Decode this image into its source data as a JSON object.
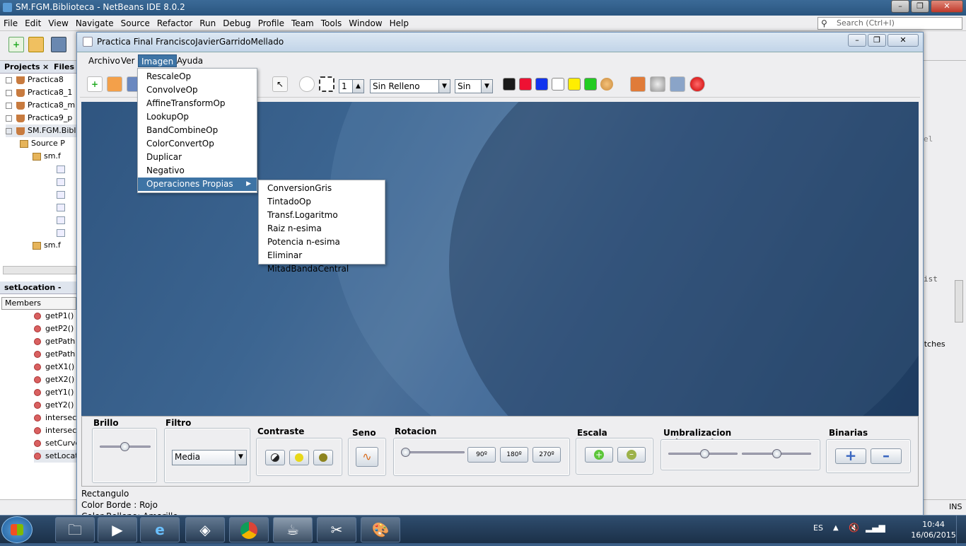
{
  "ide": {
    "title": "SM.FGM.Biblioteca - NetBeans IDE 8.0.2",
    "menu": [
      "File",
      "Edit",
      "View",
      "Navigate",
      "Source",
      "Refactor",
      "Run",
      "Debug",
      "Profile",
      "Team",
      "Tools",
      "Window",
      "Help"
    ],
    "search_placeholder": "Search (Ctrl+I)",
    "projects_tab": "Projects",
    "files_tab": "Files",
    "projects": [
      "Practica8",
      "Practica8_1",
      "Practica8_m",
      "Practica9_p",
      "SM.FGM.Bibli",
      "Source P",
      "sm.f",
      "sm.f"
    ],
    "navigator_title": "setLocation - Navi",
    "members_label": "Members",
    "members": [
      "getP1()",
      "getP2()",
      "getPath",
      "getPath",
      "getX1()",
      "getX2()",
      "getY1()",
      "getY2()",
      "intersec",
      "intersec",
      "setCurve",
      "setLocat"
    ],
    "right_strip_texts": [
      "el",
      "ist",
      "atches"
    ],
    "status_ins": "INS"
  },
  "app": {
    "title": "Practica Final FranciscoJavierGarridoMellado",
    "menu": {
      "archivo": "Archivo",
      "ver": "Ver",
      "imagen": "Imagen",
      "ayuda": "Ayuda"
    },
    "toolbar": {
      "stroke_value": "1",
      "fill_combo": "Sin Relleno",
      "sin_combo": "Sin",
      "colors": [
        "#1a1a1a",
        "#ee1133",
        "#1133ee",
        "#ffffff",
        "#ffee00",
        "#22cc22"
      ]
    },
    "imagen_menu": [
      "RescaleOp",
      "ConvolveOp",
      "AffineTransformOp",
      "LookupOp",
      "BandCombineOp",
      "ColorConvertOp",
      "Duplicar",
      "Negativo",
      "Operaciones Propias"
    ],
    "submenu": [
      "ConversionGris",
      "TintadoOp",
      "Transf.Logaritmo",
      "Raiz n-esima",
      "Potencia n-esima",
      "Eliminar MitadBandaCentral"
    ],
    "panel": {
      "brillo": "Brillo",
      "filtro": "Filtro",
      "filtro_value": "Media",
      "contraste": "Contraste",
      "seno": "Seno",
      "rotacion": "Rotacion",
      "rot_labels": [
        "90º",
        "180º",
        "270º"
      ],
      "escala": "Escala",
      "umbral": "Umbralizacion Color y Gris",
      "binarias": "Binarias"
    },
    "status": [
      "Rectangulo",
      "Color Borde : Rojo",
      "Color Relleno: Amarillo"
    ]
  },
  "taskbar": {
    "lang": "ES",
    "time": "10:44",
    "date": "16/06/2015"
  }
}
